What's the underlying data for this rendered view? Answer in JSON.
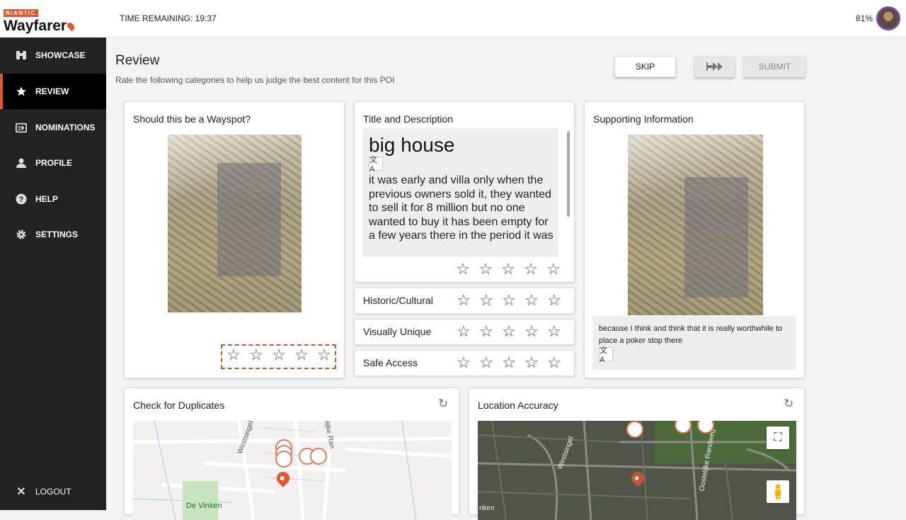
{
  "header": {
    "brand_small": "NIANTIC",
    "brand": "Wayfarer",
    "timer": "TIME REMAINING: 19:37",
    "progress_percent": "81%"
  },
  "sidebar": {
    "items": [
      {
        "label": "SHOWCASE",
        "icon": "binoculars-icon"
      },
      {
        "label": "REVIEW",
        "icon": "star-icon"
      },
      {
        "label": "NOMINATIONS",
        "icon": "nominations-icon"
      },
      {
        "label": "PROFILE",
        "icon": "person-icon"
      },
      {
        "label": "HELP",
        "icon": "help-icon"
      },
      {
        "label": "SETTINGS",
        "icon": "gear-icon"
      }
    ],
    "logout": "LOGOUT"
  },
  "main": {
    "title": "Review",
    "subtitle": "Rate the following categories to help us judge the best content for this POI",
    "buttons": {
      "skip": "SKIP",
      "submit": "SUBMIT"
    }
  },
  "cards": {
    "wayspot": {
      "title": "Should this be a Wayspot?"
    },
    "title_desc": {
      "title": "Title and Description",
      "poi_title": "big house",
      "description": "it was early and villa only when the previous owners sold it, they wanted to sell it for 8 million but no one wanted to buy it has been empty for a few years there in the period it was"
    },
    "categories": [
      {
        "label": "Historic/Cultural"
      },
      {
        "label": "Visually Unique"
      },
      {
        "label": "Safe Access"
      }
    ],
    "supporting": {
      "title": "Supporting Information",
      "text": "because I think and think that it is really worthwhile to place a poker stop there"
    },
    "duplicates": {
      "title": "Check for Duplicates",
      "streets": [
        "Westsingel",
        "De Vinken",
        "elijke Ran"
      ]
    },
    "location": {
      "title": "Location Accuracy",
      "streets": [
        "Westsingel",
        "Oostelijke Randweg",
        "nken"
      ]
    }
  },
  "star_glyph": "☆",
  "translate_glyph": "文A"
}
